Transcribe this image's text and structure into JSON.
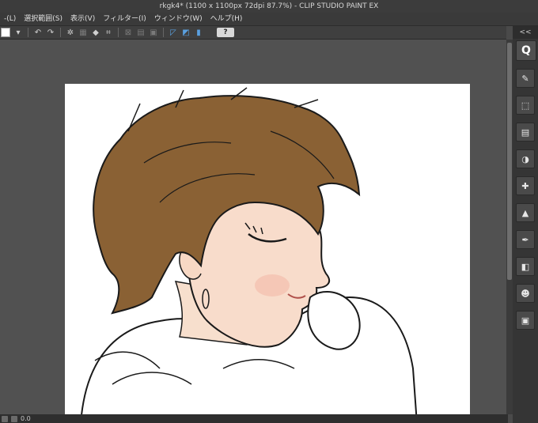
{
  "window": {
    "title": "rkgk4* (1100 x 1100px 72dpi 87.7%) - CLIP STUDIO PAINT EX"
  },
  "menu": [
    "-(L)",
    "選択範囲(S)",
    "表示(V)",
    "フィルター(I)",
    "ウィンドウ(W)",
    "ヘルプ(H)"
  ],
  "toolbar": {
    "icons": [
      "color-swatch-icon",
      "dropdown-arrow-icon",
      "undo-icon",
      "redo-icon",
      "snap-icon",
      "transform-icon",
      "fill-icon",
      "crop-icon",
      "ruler-icon",
      "grid-icon",
      "perspective-icon",
      "pen-pressure-icon",
      "symmetry-icon",
      "stabilizer-icon"
    ],
    "help_label": "?"
  },
  "right_dock": {
    "top_label": "<<",
    "search_label": "Q",
    "icons": [
      "brush-icon",
      "select-icon",
      "layer-icon",
      "palette-icon",
      "navigator-icon",
      "image-icon",
      "pen-icon",
      "material-icon",
      "user-icon",
      "clipboard-icon"
    ]
  },
  "status": {
    "zoom": "0.0"
  },
  "colors": {
    "hair": "#8a6134",
    "skin": "#f6dcc8",
    "lineart": "#1a1a1a",
    "canvas": "#ffffff"
  }
}
